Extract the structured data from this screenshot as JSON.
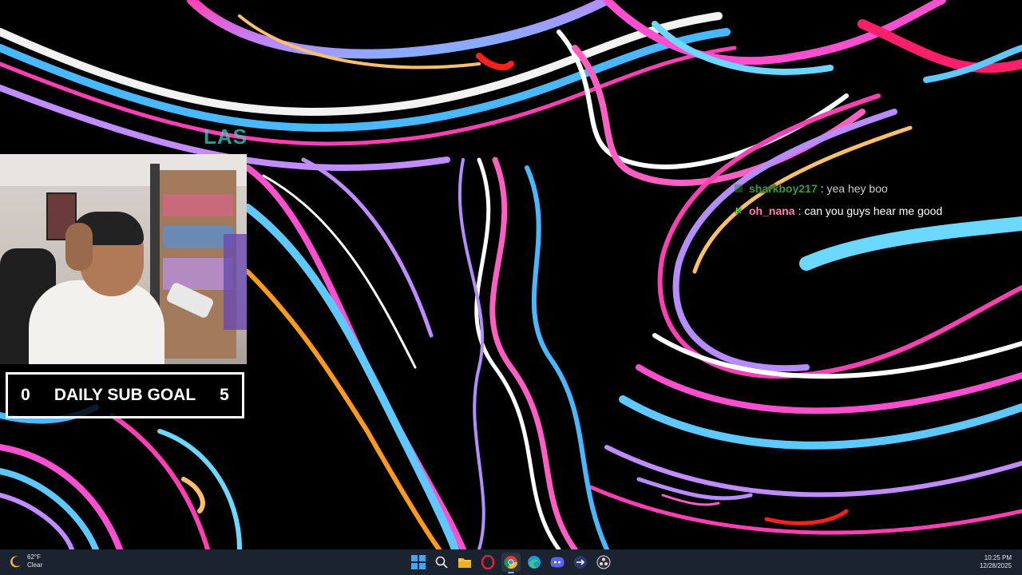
{
  "overlay": {
    "text": "LAS"
  },
  "sub_goal": {
    "current": "0",
    "label": "DAILY SUB GOAL",
    "target": "5"
  },
  "chat": [
    {
      "username": "sharkboy217",
      "message": "yea hey boo",
      "color": "#2e9e3d",
      "badge_color": "#2e7d32"
    },
    {
      "username": "oh_nana",
      "message": "can you guys hear me good",
      "color": "#ff7fb6",
      "badge": "K",
      "badge_color": "#53fc18"
    }
  ],
  "weather": {
    "temp": "62°F",
    "condition": "Clear",
    "icon": "moon-icon"
  },
  "taskbar": {
    "icons": [
      "windows-start-icon",
      "search-icon",
      "file-explorer-icon",
      "opera-gx-icon",
      "chrome-icon",
      "edge-icon",
      "discord-icon",
      "app-arrow-icon",
      "obs-icon"
    ],
    "active": "chrome-icon"
  },
  "clock": {
    "time": "10:25 PM",
    "date": "12/28/2025"
  }
}
